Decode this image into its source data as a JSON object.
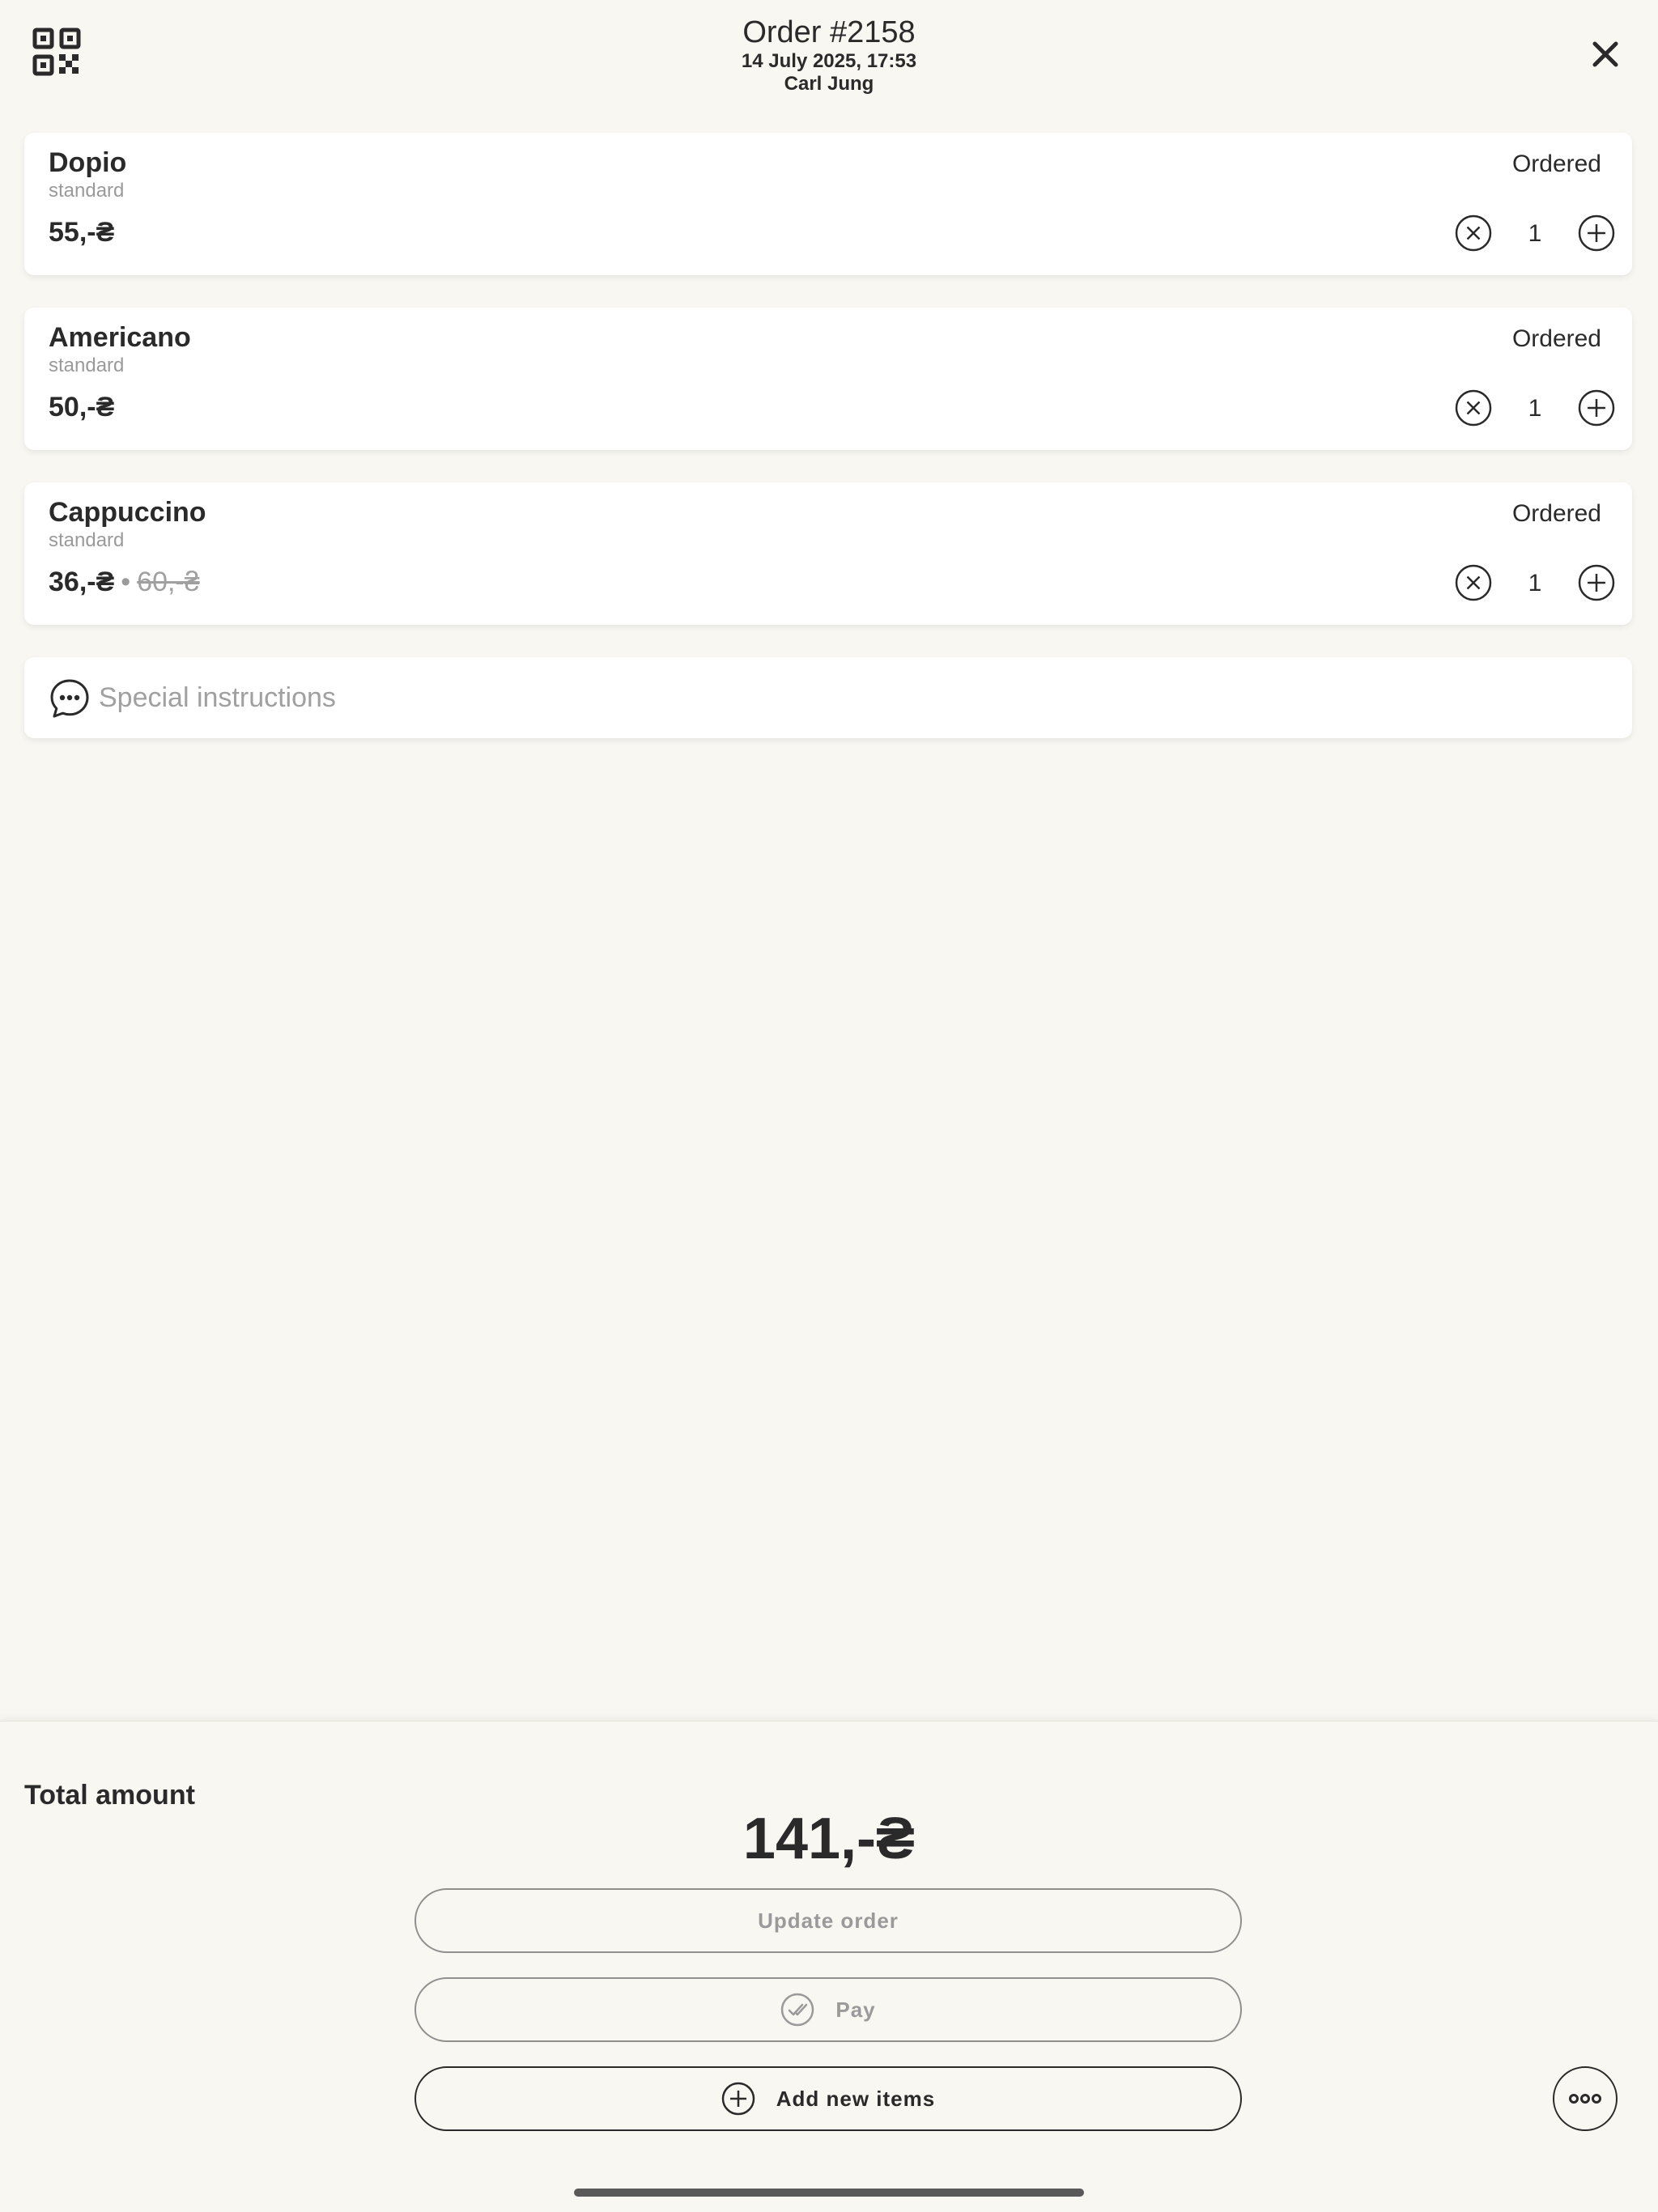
{
  "header": {
    "title": "Order #2158",
    "date": "14 July 2025, 17:53",
    "customer": "Carl Jung",
    "qr_icon": "qr-code-icon",
    "close_icon": "close-icon"
  },
  "items": [
    {
      "name": "Dopio",
      "variant": "standard",
      "status": "Ordered",
      "price": "55,-₴",
      "old_price": "",
      "quantity": "1"
    },
    {
      "name": "Americano",
      "variant": "standard",
      "status": "Ordered",
      "price": "50,-₴",
      "old_price": "",
      "quantity": "1"
    },
    {
      "name": "Cappuccino",
      "variant": "standard",
      "status": "Ordered",
      "price": "36,-₴",
      "price_separator": "•",
      "old_price": "60,-₴",
      "quantity": "1"
    }
  ],
  "instructions": {
    "placeholder": "Special instructions",
    "value": "",
    "icon": "chat-bubble-icon"
  },
  "footer": {
    "total_label": "Total amount",
    "total_amount": "141,-₴",
    "update_label": "Update order",
    "pay_label": "Pay",
    "add_label": "Add new items",
    "more_icon": "more-options-icon"
  },
  "colors": {
    "background": "#f8f7f2",
    "card": "#ffffff",
    "text": "#2a2a2a",
    "muted": "#9a9a9a"
  }
}
